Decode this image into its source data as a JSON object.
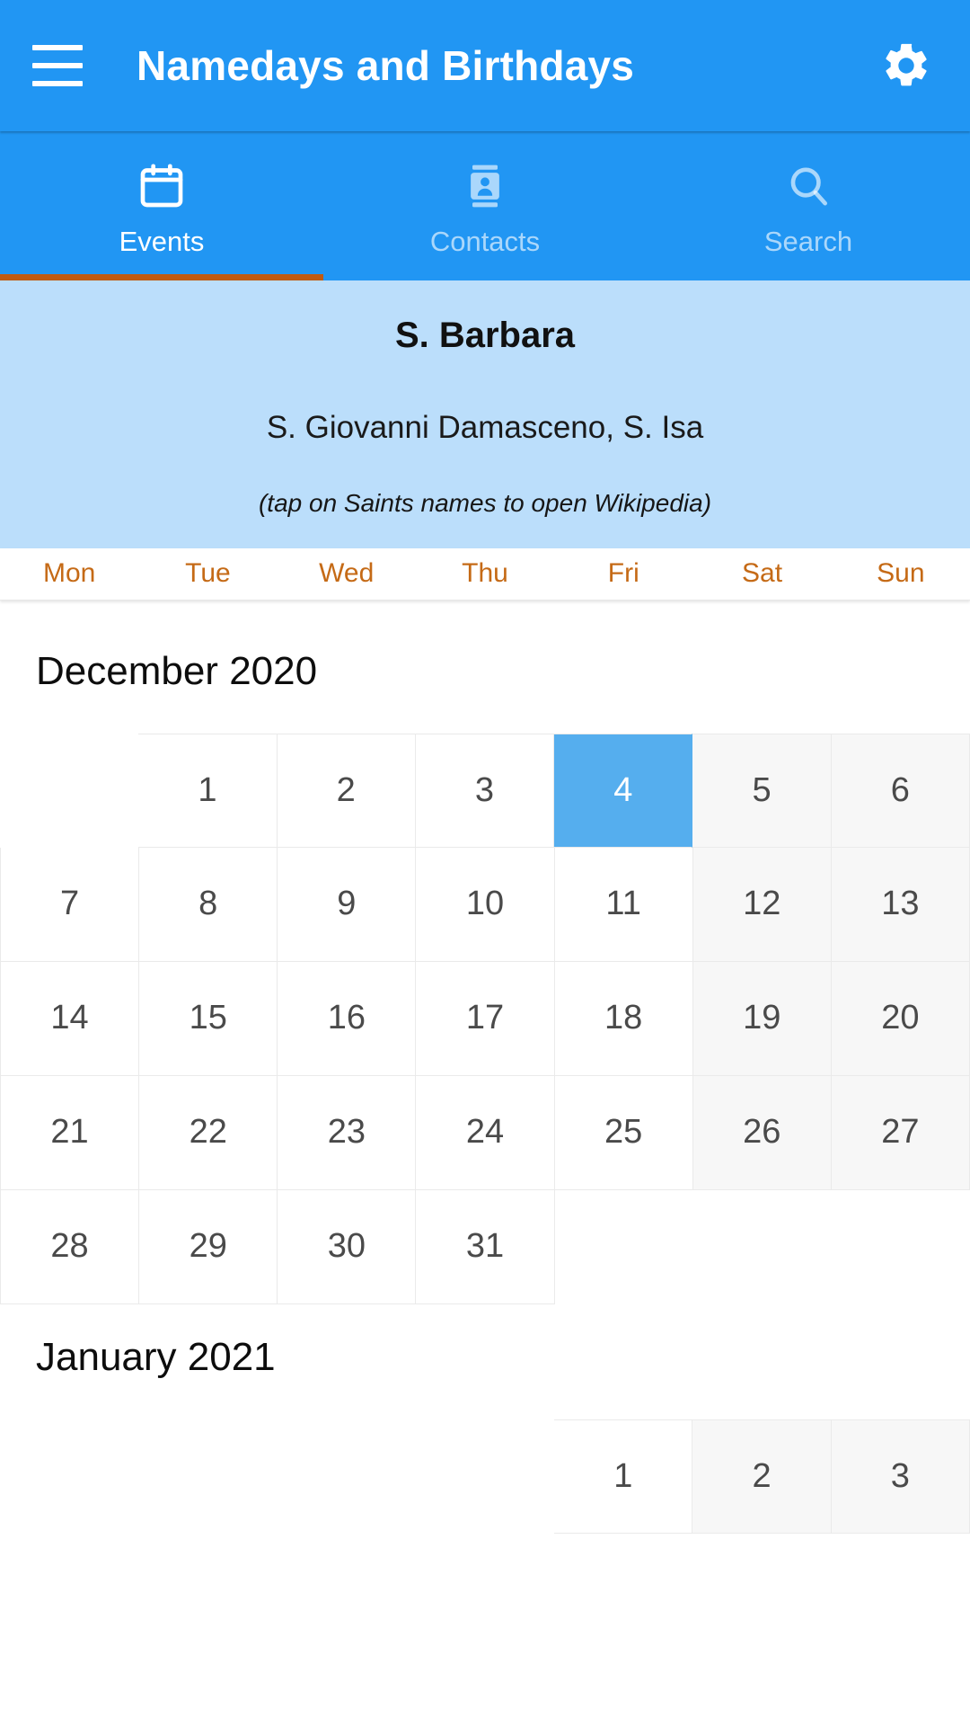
{
  "appbar": {
    "title": "Namedays and Birthdays",
    "menu_icon": "hamburger-menu-icon",
    "settings_icon": "gear-icon",
    "background_color": "#2196f3"
  },
  "tabs": [
    {
      "label": "Events",
      "icon": "calendar-icon",
      "active": true
    },
    {
      "label": "Contacts",
      "icon": "contact-card-icon",
      "active": false
    },
    {
      "label": "Search",
      "icon": "search-icon",
      "active": false
    }
  ],
  "tab_indicator_color": "#c05a10",
  "saints": {
    "main_name": "S. Barbara",
    "other_names": "S. Giovanni Damasceno, S. Isa",
    "hint": "(tap on Saints names to open Wikipedia)",
    "background_color": "#bbdefb"
  },
  "weekdays": [
    "Mon",
    "Tue",
    "Wed",
    "Thu",
    "Fri",
    "Sat",
    "Sun"
  ],
  "weekday_color": "#c56a16",
  "selected_day": {
    "day": 4,
    "month": "December",
    "year": 2020,
    "color": "#55aeee"
  },
  "months": [
    {
      "title": "December 2020",
      "weeks": [
        [
          "",
          "1",
          "2",
          "3",
          "4",
          "5",
          "6"
        ],
        [
          "7",
          "8",
          "9",
          "10",
          "11",
          "12",
          "13"
        ],
        [
          "14",
          "15",
          "16",
          "17",
          "18",
          "19",
          "20"
        ],
        [
          "21",
          "22",
          "23",
          "24",
          "25",
          "26",
          "27"
        ],
        [
          "28",
          "29",
          "30",
          "31",
          "",
          "",
          ""
        ]
      ]
    },
    {
      "title": "January 2021",
      "weeks": [
        [
          "",
          "",
          "",
          "",
          "1",
          "2",
          "3"
        ]
      ]
    }
  ]
}
